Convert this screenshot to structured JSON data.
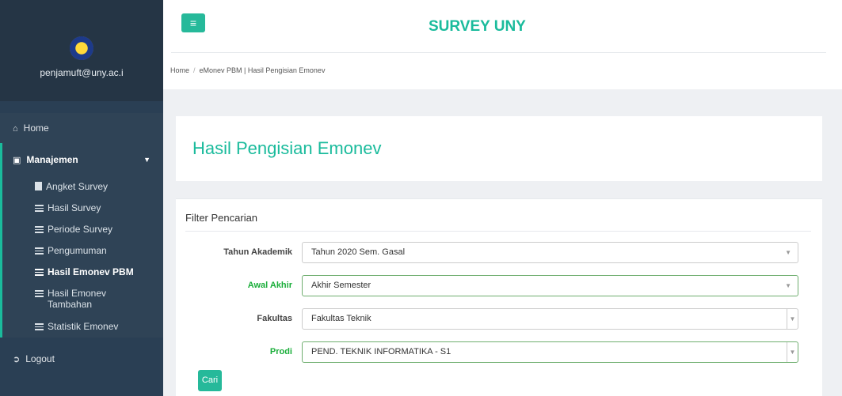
{
  "sidebar": {
    "email": "penjamuft@uny.ac.i",
    "home": "Home",
    "section": "Manajemen",
    "items": [
      {
        "label": "Angket Survey",
        "icon": "file-icon"
      },
      {
        "label": "Hasil Survey",
        "icon": "list-icon"
      },
      {
        "label": "Periode Survey",
        "icon": "list-icon"
      },
      {
        "label": "Pengumuman",
        "icon": "list-icon"
      },
      {
        "label": "Hasil Emonev PBM",
        "icon": "list-icon",
        "active": true
      },
      {
        "label": "Hasil Emonev Tambahan",
        "icon": "list-icon"
      },
      {
        "label": "Statistik Emonev",
        "icon": "list-icon"
      }
    ],
    "logout": "Logout"
  },
  "header": {
    "brand": "SURVEY UNY",
    "breadcrumb": [
      "Home",
      "eMonev PBM | Hasil Pengisian Emonev"
    ]
  },
  "main": {
    "title": "Hasil Pengisian Emonev",
    "filter": {
      "title": "Filter Pencarian",
      "rows": [
        {
          "label": "Tahun Akademik",
          "value": "Tahun 2020 Sem. Gasal"
        },
        {
          "label": "Awal Akhir",
          "value": "Akhir Semester"
        },
        {
          "label": "Fakultas",
          "value": "Fakultas Teknik"
        },
        {
          "label": "Prodi",
          "value": "PEND. TEKNIK INFORMATIKA - S1"
        }
      ],
      "button": "Cari"
    }
  },
  "colors": {
    "accent": "#1abb9c",
    "sidebar": "#2a3f54",
    "valid_label": "#1aae3a"
  }
}
